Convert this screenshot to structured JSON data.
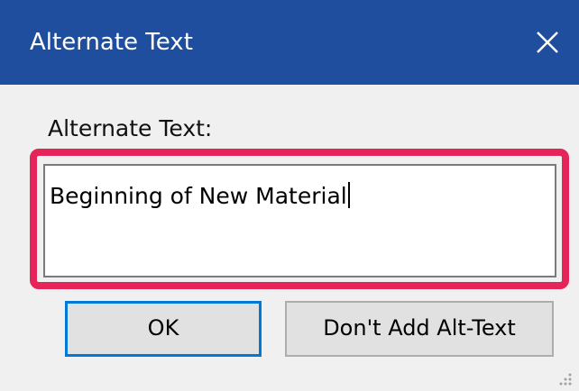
{
  "dialog": {
    "title": "Alternate Text",
    "close_icon": "close-icon",
    "field_label": "Alternate Text:",
    "text_value": "Beginning of New Material",
    "buttons": {
      "ok": "OK",
      "dont_add": "Don't Add Alt-Text"
    }
  },
  "colors": {
    "titlebar": "#1f4e9e",
    "highlight": "#e5245a",
    "focus_border": "#0078d7",
    "background": "#f0f0f0"
  }
}
